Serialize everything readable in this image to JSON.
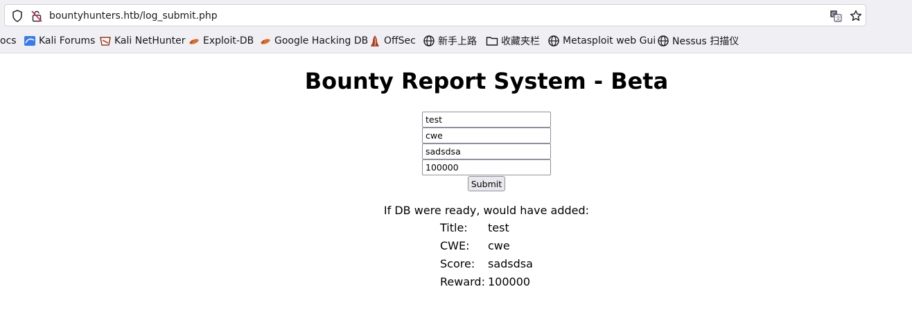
{
  "browser": {
    "url": "bountyhunters.htb/log_submit.php",
    "bookmarks": [
      {
        "label": "ocs",
        "icon": "none"
      },
      {
        "label": "Kali Forums",
        "icon": "kali-forums-icon"
      },
      {
        "label": "Kali NetHunter",
        "icon": "kali-nethunter-icon"
      },
      {
        "label": "Exploit-DB",
        "icon": "exploit-db-icon"
      },
      {
        "label": "Google Hacking DB",
        "icon": "ghdb-icon"
      },
      {
        "label": "OffSec",
        "icon": "offsec-icon"
      },
      {
        "label": "新手上路",
        "icon": "globe-icon"
      },
      {
        "label": "收藏夹栏",
        "icon": "folder-icon"
      },
      {
        "label": "Metasploit web Gui",
        "icon": "globe-icon"
      },
      {
        "label": "Nessus 扫描仪",
        "icon": "globe-icon"
      }
    ]
  },
  "page": {
    "title": "Bounty Report System - Beta",
    "form": {
      "title_value": "test",
      "cwe_value": "cwe",
      "score_value": "sadsdsa",
      "reward_value": "100000",
      "submit_label": "Submit"
    },
    "result": {
      "heading": "If DB were ready, would have added:",
      "rows": [
        {
          "label": "Title:",
          "value": "test"
        },
        {
          "label": "CWE:",
          "value": "cwe"
        },
        {
          "label": "Score:",
          "value": "sadsdsa"
        },
        {
          "label": "Reward:",
          "value": "100000"
        }
      ]
    }
  },
  "colors": {
    "chrome_bg": "#f0f0f4",
    "exploit_icon": "#e06a2c"
  }
}
